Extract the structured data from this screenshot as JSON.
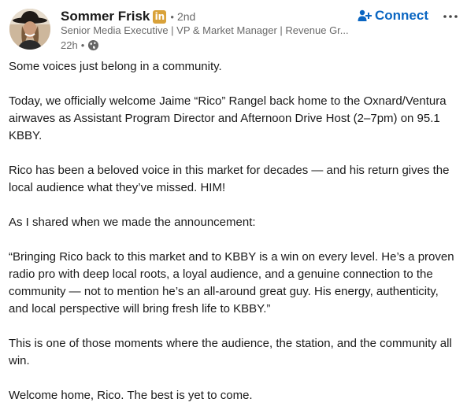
{
  "author": {
    "name": "Sommer Frisk",
    "badge_icon": "linkedin-premium-icon",
    "badge_text": "in",
    "degree_separator": "•",
    "degree": "2nd",
    "headline": "Senior Media Executive | VP & Market Manager | Revenue Gr...",
    "time": "22h",
    "meta_separator": "•",
    "visibility_icon": "globe-icon"
  },
  "actions": {
    "connect_label": "Connect",
    "connect_icon": "person-plus-icon",
    "more_icon": "more-horizontal-icon"
  },
  "post": {
    "paragraphs": [
      "Some voices just belong in a community.",
      "Today, we officially welcome Jaime “Rico” Rangel back home to the Oxnard/Ventura airwaves as Assistant Program Director and Afternoon Drive Host (2–7pm) on 95.1 KBBY.",
      "Rico has been a beloved voice in this market for decades — and his return gives the local audience what they’ve missed. HIM!",
      "As I shared when we made the announcement:",
      "“Bringing Rico back to this market and to KBBY is a win on every level. He’s a proven radio pro with deep local roots, a loyal audience, and a genuine connection to the community — not to mention he’s an all-around great guy. His energy, authenticity, and local perspective will bring fresh life to KBBY.”",
      "This is one of those moments where the audience, the station, and the community all win.",
      "Welcome home, Rico. The best is yet to come."
    ]
  },
  "colors": {
    "accent": "#0a66c2",
    "premium_badge": "#d9a23a",
    "text_primary": "rgba(0,0,0,0.9)",
    "text_secondary": "rgba(0,0,0,0.6)"
  }
}
